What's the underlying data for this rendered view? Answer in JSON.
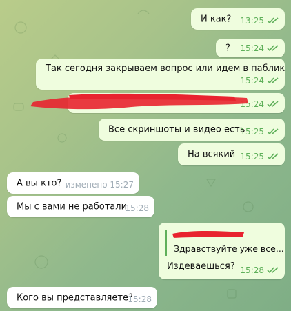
{
  "messages": [
    {
      "text": "И как?",
      "time": "13:25",
      "dir": "out"
    },
    {
      "text": "?",
      "time": "15:24",
      "dir": "out"
    },
    {
      "text": "Так сегодня закрываем вопрос или идем в паблик",
      "time": "15:24",
      "dir": "out"
    },
    {
      "text": "",
      "time": "15:24",
      "dir": "out"
    },
    {
      "text": "Все скриншоты и видео есть",
      "time": "15:25",
      "dir": "out"
    },
    {
      "text": "На всякий",
      "time": "15:25",
      "dir": "out"
    },
    {
      "text": "А вы кто?",
      "edited": "изменено 15:27",
      "dir": "in"
    },
    {
      "text": "Мы с вами не работали",
      "time": "15:28",
      "dir": "in"
    },
    {
      "reply_text": "Здравствуйте уже все...",
      "text": "Издеваешься?",
      "time": "15:28",
      "dir": "out"
    },
    {
      "text": "Кого вы представляете?",
      "time": "15:28",
      "dir": "in"
    }
  ],
  "colors": {
    "outgoing": "#effdde",
    "incoming": "#ffffff",
    "check": "#5fb05a",
    "redaction": "#e8232f"
  }
}
